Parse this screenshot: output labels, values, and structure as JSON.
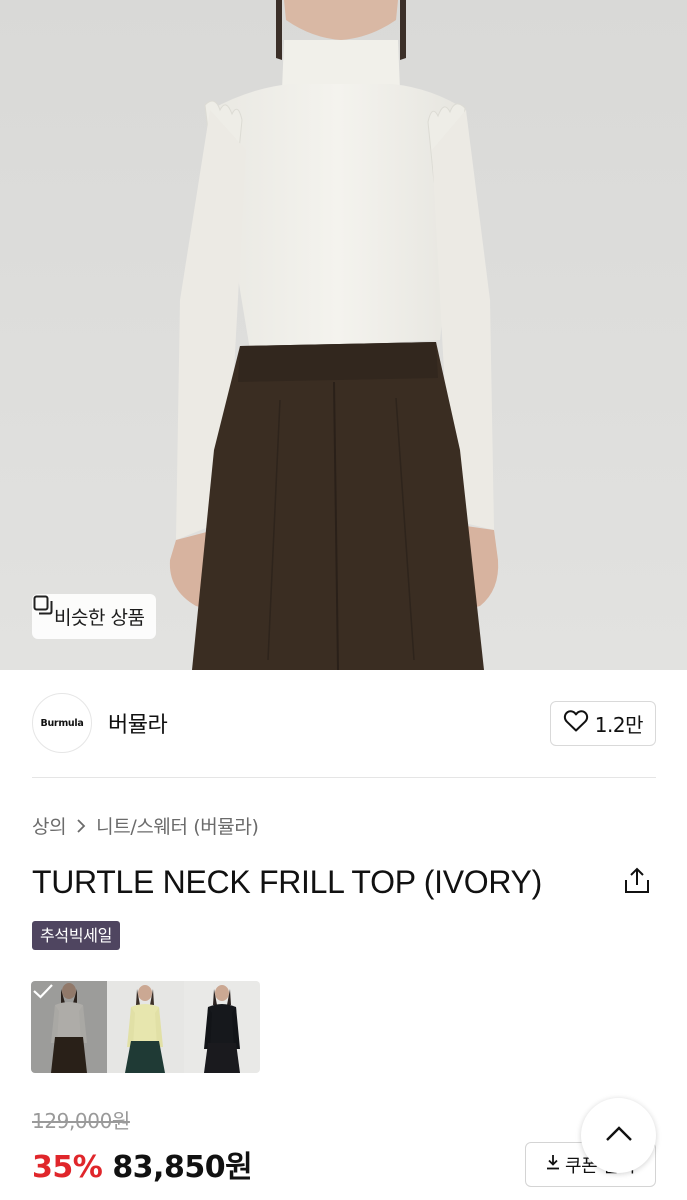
{
  "hero": {
    "similar_products_label": "비슷한 상품"
  },
  "brand": {
    "logo_text": "Burmula",
    "name": "버뮬라",
    "like_count": "1.2만"
  },
  "breadcrumb": {
    "category": "상의",
    "subcategory": "니트/스웨터 (버뮬라)"
  },
  "product": {
    "title": "TURTLE NECK FRILL TOP (IVORY)",
    "badge": "추석빅세일"
  },
  "color_options": {
    "items": [
      {
        "name": "ivory",
        "selected": true
      },
      {
        "name": "yellow",
        "selected": false
      },
      {
        "name": "black",
        "selected": false
      }
    ]
  },
  "price": {
    "original": "129,000원",
    "discount": "35%",
    "final": "83,850원"
  },
  "coupon": {
    "label": "쿠폰 받기"
  },
  "colors": {
    "accent_red": "#e0262b",
    "badge_bg": "#4f4560"
  }
}
